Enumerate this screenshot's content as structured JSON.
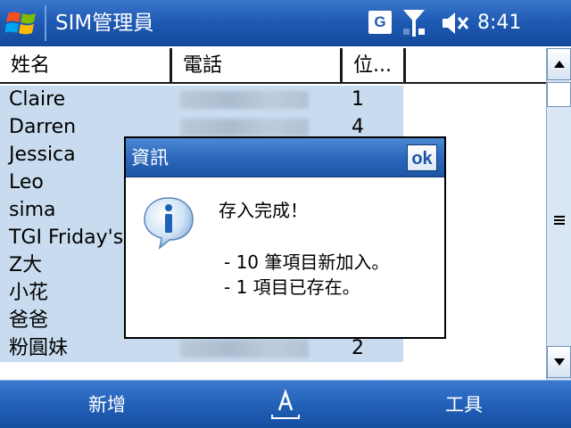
{
  "titlebar": {
    "app_title": "SIM管理員",
    "tray_g": "G",
    "clock": "8:41",
    "icons": [
      "windows-start-icon",
      "signal-icon",
      "speaker-muted-icon"
    ]
  },
  "list": {
    "columns": [
      "姓名",
      "電話",
      "位..."
    ],
    "rows": [
      {
        "name": "Claire",
        "pos": "1"
      },
      {
        "name": "Darren",
        "pos": "4"
      },
      {
        "name": "Jessica",
        "pos": ""
      },
      {
        "name": "Leo",
        "pos": ""
      },
      {
        "name": "sima",
        "pos": ""
      },
      {
        "name": "TGI Friday's",
        "pos": ""
      },
      {
        "name": "Z大",
        "pos": ""
      },
      {
        "name": "小花",
        "pos": ""
      },
      {
        "name": "爸爸",
        "pos": ""
      },
      {
        "name": "粉圓妹",
        "pos": "2"
      }
    ]
  },
  "dialog": {
    "title": "資訊",
    "ok_label": "ok",
    "headline": "存入完成！",
    "lines": [
      "- 10 筆項目新加入。",
      "- 1 項目已存在。"
    ],
    "icon": "info-icon"
  },
  "menubar": {
    "left_label": "新增",
    "right_label": "工具",
    "center_icon": "keyboard-input-icon"
  },
  "colors": {
    "titlebar_blue": "#1f5ab4",
    "list_highlight": "#c9dcef",
    "menubar_blue": "#2261b8"
  }
}
